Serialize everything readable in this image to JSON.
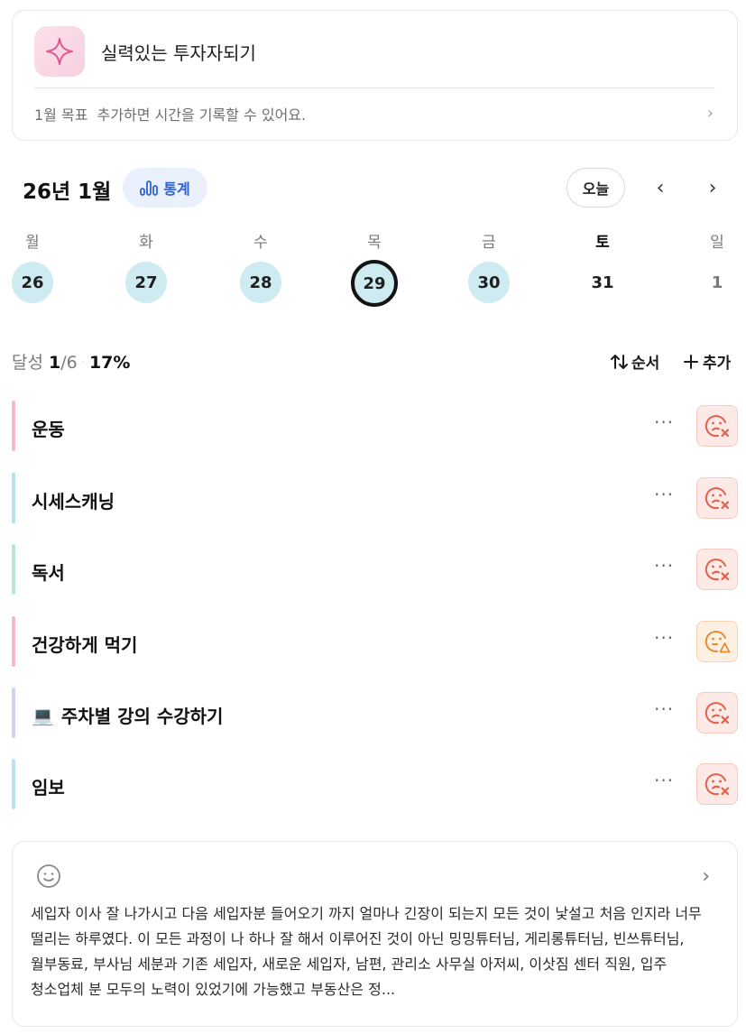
{
  "goal": {
    "title": "실력있는 투자자되기",
    "subtitle": "1월 목표  추가하면 시간을 기록할 수 있어요.",
    "chevron": "›",
    "icon": "sparkle-icon",
    "accent_color": "#e85a9a"
  },
  "calendar": {
    "month_title": "26년 1월",
    "stats_label": "통계",
    "today_label": "오늘",
    "prev": "‹",
    "next": "›",
    "weekdays": [
      "월",
      "화",
      "수",
      "목",
      "금",
      "토",
      "일"
    ],
    "days": [
      "26",
      "27",
      "28",
      "29",
      "30",
      "31",
      "1"
    ],
    "day_states": [
      "done",
      "done",
      "done",
      "today",
      "done",
      "none",
      "none"
    ]
  },
  "progress": {
    "label": "달성",
    "done": "1",
    "total": "/6",
    "separator": "·",
    "percent": "17%",
    "sort_label": "순서",
    "add_label": "추가"
  },
  "habits": [
    {
      "name": "운동",
      "status": "fail",
      "color": "#f4b9cf",
      "emoji": ""
    },
    {
      "name": "시세스캐닝",
      "status": "fail",
      "color": "#b8e3ec",
      "emoji": ""
    },
    {
      "name": "독서",
      "status": "fail",
      "color": "#b7e6d6",
      "emoji": ""
    },
    {
      "name": "건강하게 먹기",
      "status": "warn",
      "color": "#f4b9cf",
      "emoji": ""
    },
    {
      "name": "주차별 강의 수강하기",
      "status": "fail",
      "color": "#c9d5f2",
      "emoji": "💻"
    },
    {
      "name": "임보",
      "status": "fail",
      "color": "#b8e3ec",
      "emoji": ""
    }
  ],
  "habit_more_label": "···",
  "diary": {
    "chevron": "›",
    "text": "세입자 이사 잘 나가시고 다음 세입자분 들어오기 까지 얼마나 긴장이 되는지 모든 것이 낯설고 처음 인지라 너무 떨리는 하루였다. 이 모든 과정이 나 하나 잘 해서 이루어진 것이 아닌 밍밍튜터님, 게리롱튜터님, 빈쓰튜터님, 월부동료, 부사님 세분과 기존 세입자, 새로운 세입자, 남편, 관리소 사무실 아저씨, 이삿짐 센터 직원, 입주 청소업체 분 모두의 노력이 있었기에 가능했고 부동산은 정..."
  }
}
